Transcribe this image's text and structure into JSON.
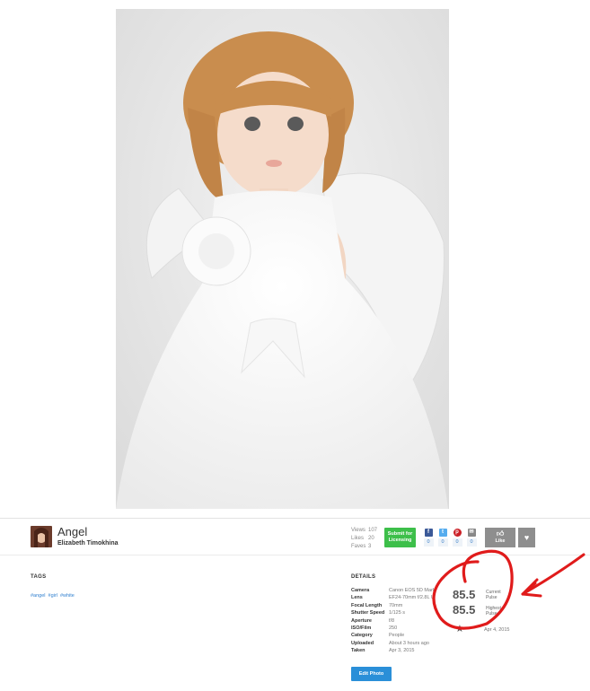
{
  "photo": {
    "title": "Angel",
    "author": "Elizabeth Timokhina"
  },
  "stats": [
    {
      "label": "Views",
      "value": "107"
    },
    {
      "label": "Likes",
      "value": "20"
    },
    {
      "label": "Faves",
      "value": "3"
    }
  ],
  "submit": {
    "line1": "Submit for",
    "line2": "Licensing"
  },
  "share": {
    "facebook": {
      "icon": "facebook-icon",
      "count": "0",
      "color": "#3b5998"
    },
    "twitter": {
      "icon": "twitter-icon",
      "count": "0",
      "color": "#55acee"
    },
    "pinterest": {
      "icon": "pinterest-icon",
      "count": "0",
      "color": "#cb2027"
    },
    "email": {
      "icon": "email-icon",
      "count": "0",
      "color": "#888888"
    }
  },
  "like": {
    "label": "Like"
  },
  "tags": {
    "heading": "TAGS",
    "items": [
      "#angel",
      "#girl",
      "#white"
    ]
  },
  "details": {
    "heading": "DETAILS",
    "rows": [
      {
        "key": "Camera",
        "value": "Canon EOS 5D Mark"
      },
      {
        "key": "Lens",
        "value": "EF24-70mm f/2.8L U"
      },
      {
        "key": "Focal Length",
        "value": "70mm"
      },
      {
        "key": "Shutter Speed",
        "value": "1/125 s"
      },
      {
        "key": "Aperture",
        "value": "f/8"
      },
      {
        "key": "ISO/Film",
        "value": "250"
      },
      {
        "key": "Category",
        "value": "People"
      },
      {
        "key": "Uploaded",
        "value": "About 3 hours ago"
      },
      {
        "key": "Taken",
        "value": "Apr 3, 2015"
      }
    ]
  },
  "pulse": {
    "current_value": "85.5",
    "current_label_1": "Current",
    "current_label_2": "Pulse",
    "highest_value": "85.5",
    "highest_label_1": "Highest",
    "highest_label_2": "Pulse",
    "date": "Apr 4, 2015"
  },
  "edit": {
    "label": "Edit Photo"
  },
  "colors": {
    "accent_green": "#3dbf4a",
    "accent_blue": "#2a8fd8",
    "annotation_red": "#e01b1b"
  }
}
